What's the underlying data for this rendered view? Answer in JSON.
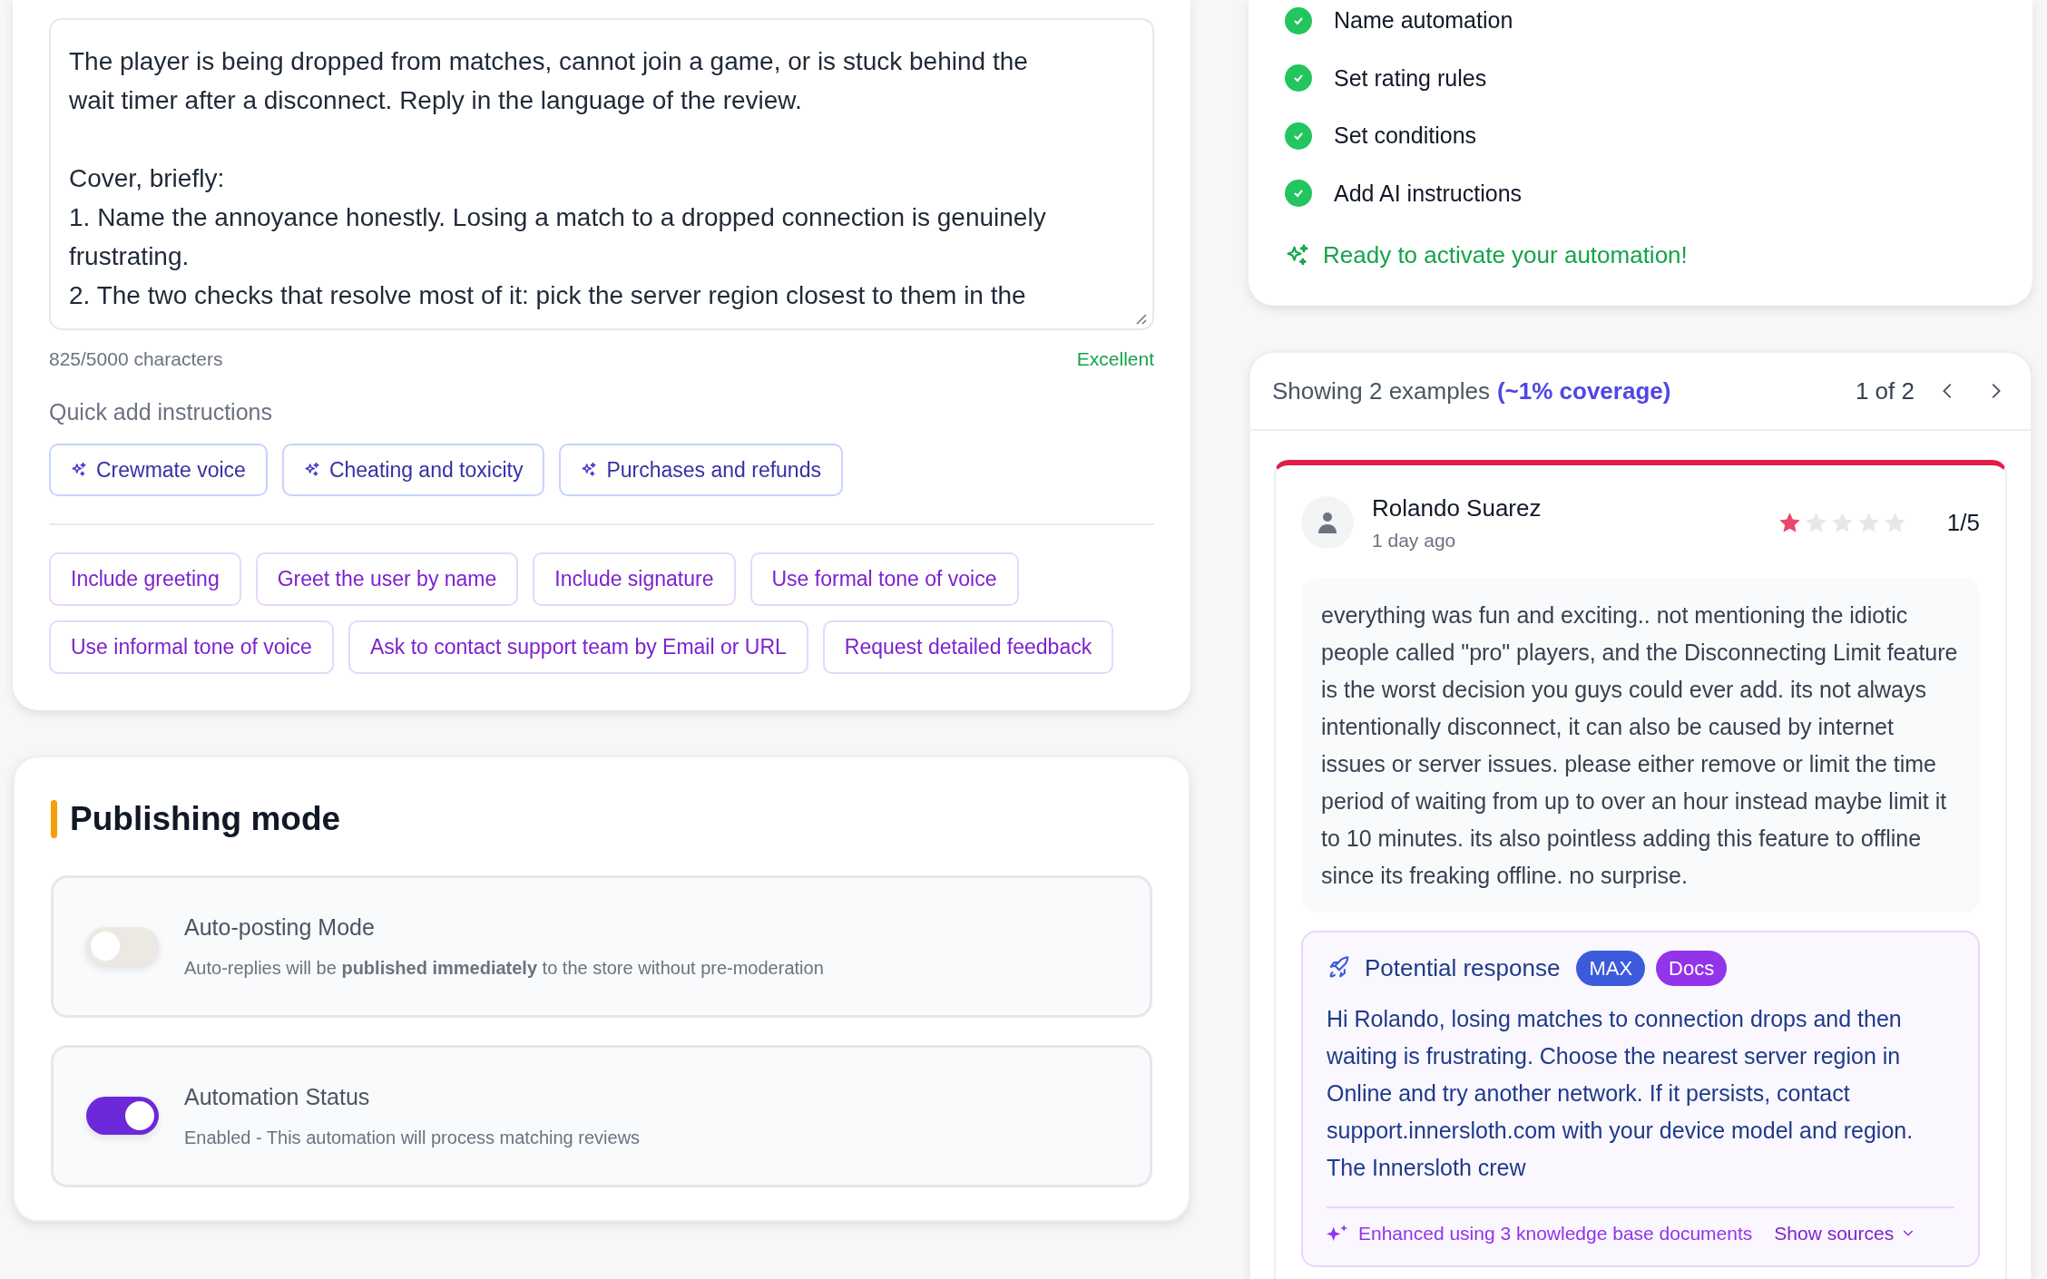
{
  "instructions": {
    "text": "The player is being dropped from matches, cannot join a game, or is stuck behind the\nwait timer after a disconnect. Reply in the language of the review.\n\nCover, briefly:\n1. Name the annoyance honestly. Losing a match to a dropped connection is genuinely\nfrustrating.\n2. The two checks that resolve most of it: pick the server region closest to them in the",
    "char_count": "825/5000 characters",
    "quality": "Excellent"
  },
  "quick_add": {
    "label": "Quick add instructions",
    "templates": [
      "Crewmate voice",
      "Cheating and toxicity",
      "Purchases and refunds"
    ],
    "options": [
      "Include greeting",
      "Greet the user by name",
      "Include signature",
      "Use formal tone of voice",
      "Use informal tone of voice",
      "Ask to contact support team by Email or URL",
      "Request detailed feedback"
    ]
  },
  "publishing_mode": {
    "title": "Publishing mode",
    "settings": [
      {
        "title": "Auto-posting Mode",
        "description": "Auto-replies will be **published immediately** to the store without pre-moderation",
        "on": false
      },
      {
        "title": "Automation Status",
        "description": "Enabled - This automation will process matching reviews",
        "on": true
      }
    ]
  },
  "checklist": {
    "steps": [
      {
        "label": "Name automation",
        "done": true
      },
      {
        "label": "Set rating rules",
        "done": true
      },
      {
        "label": "Set conditions",
        "done": true
      },
      {
        "label": "Add AI instructions",
        "done": true
      }
    ],
    "ready_message": "Ready to activate your automation!"
  },
  "examples": {
    "summary": "Showing 2 examples",
    "coverage": "(~1% coverage)",
    "pager": "1 of 2",
    "review": {
      "author": "Rolando Suarez",
      "time": "1 day ago",
      "stars": 1,
      "score": "1/5",
      "body": "everything was fun and exciting.. not mentioning the idiotic people called \"pro\" players, and the Disconnecting Limit feature is the worst decision you guys could ever add. its not always intentionally disconnect, it can also be caused by internet issues or server issues. please either remove or limit the time period of waiting from up to over an hour instead maybe limit it to 10 minutes. its also pointless adding this feature to offline since its freaking offline. no surprise."
    },
    "response": {
      "title": "Potential response",
      "badges": [
        "MAX",
        "Docs"
      ],
      "body": "Hi Rolando, losing matches to connection drops and then waiting is frustrating. Choose the nearest server region in Online and try another network. If it persists, contact support.innersloth.com with your device model and region. The Innersloth crew",
      "footer": "Enhanced using 3 knowledge base documents",
      "sources_link": "Show sources"
    }
  }
}
